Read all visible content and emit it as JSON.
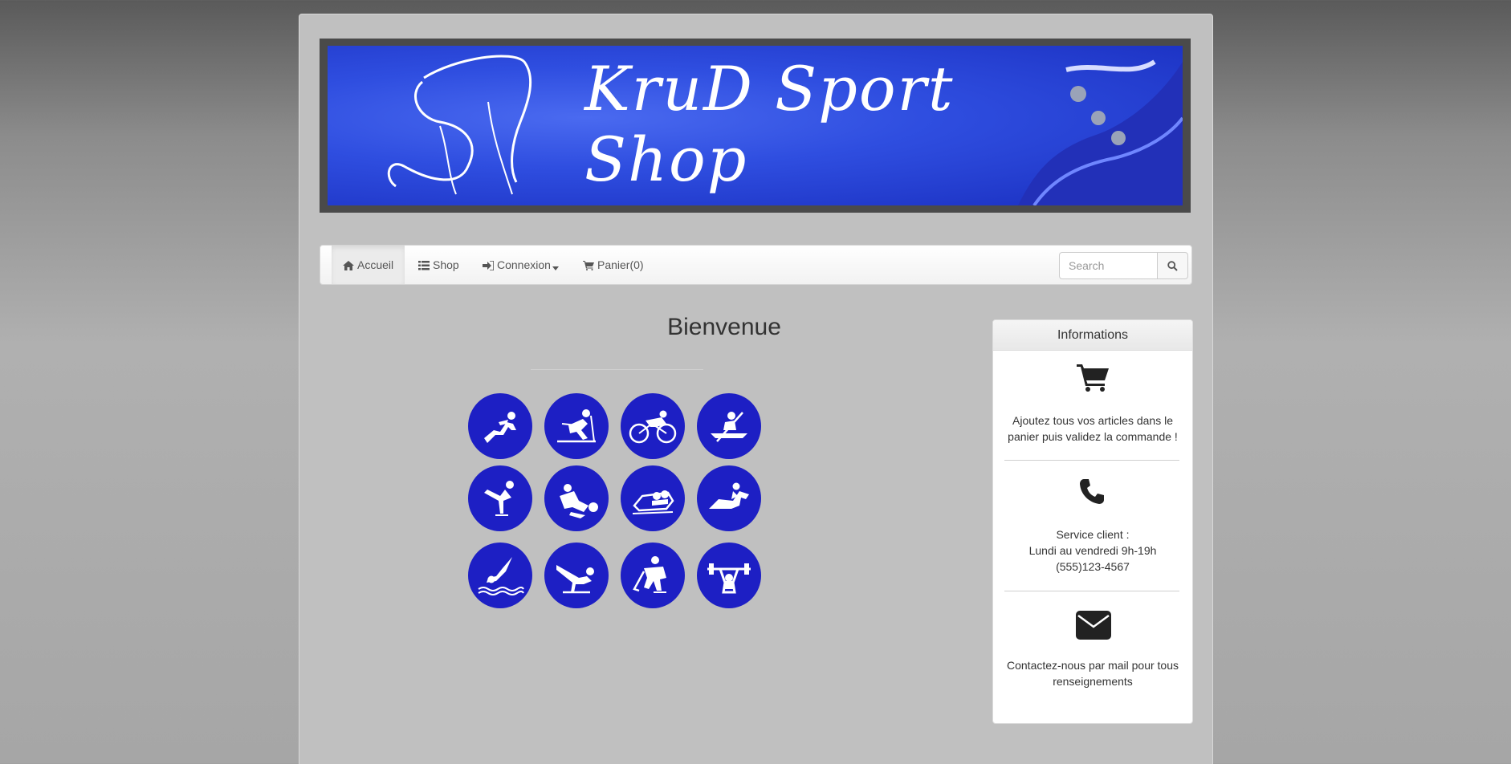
{
  "banner": {
    "title_line1": "KruD Sport",
    "title_line2": "Shop"
  },
  "nav": {
    "home": "Accueil",
    "shop": "Shop",
    "login": "Connexion",
    "cart": "Panier(0)",
    "search_placeholder": "Search"
  },
  "main": {
    "welcome": "Bienvenue",
    "sports": [
      "running",
      "cross-country-skiing",
      "cycling",
      "canoeing",
      "figure-skating",
      "wrestling",
      "bobsleigh",
      "equestrian",
      "diving",
      "gymnastics",
      "ice-hockey",
      "weightlifting"
    ]
  },
  "sidebar": {
    "title": "Informations",
    "cart_text": "Ajoutez tous vos articles dans le panier puis validez la commande !",
    "service_label": "Service client :",
    "service_hours": "Lundi au vendredi 9h-19h",
    "service_phone": "(555)123-4567",
    "mail_text": "Contactez-nous par mail pour tous renseignements"
  },
  "colors": {
    "accent": "#1d1fc4",
    "banner": "#2f4ee0"
  }
}
